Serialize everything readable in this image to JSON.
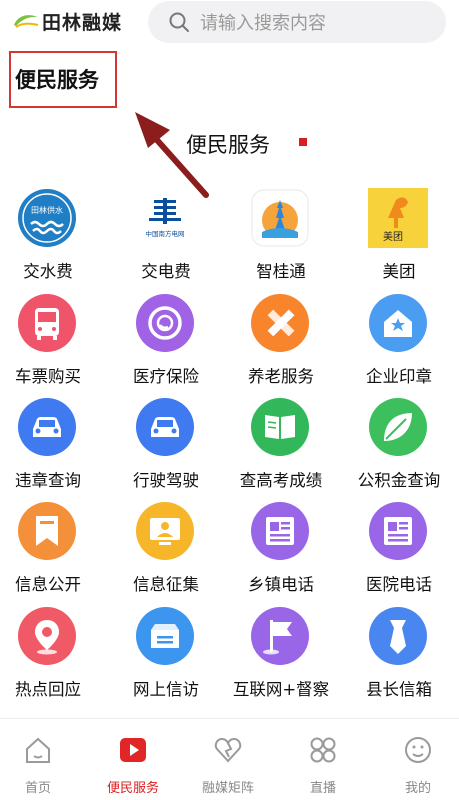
{
  "header": {
    "logo_text": "田林融媒",
    "logo_small": "Tianlin",
    "search_placeholder": "请输入搜索内容"
  },
  "annotation": {
    "label": "便民服务"
  },
  "section": {
    "title": "便民服务"
  },
  "services": [
    {
      "label": "交水费",
      "icon": "water-company-icon",
      "color": "#1f7ec4"
    },
    {
      "label": "交电费",
      "icon": "china-southern-grid-icon",
      "color": "#0a4f9b",
      "caption": "中国南方电网"
    },
    {
      "label": "智桂通",
      "icon": "zhiguitong-icon",
      "color": "#3aa0dd"
    },
    {
      "label": "美团",
      "icon": "meituan-icon",
      "color": "#f7d23b",
      "caption": "美团"
    },
    {
      "label": "车票购买",
      "icon": "bus-icon",
      "color": "#f0546a"
    },
    {
      "label": "医疗保险",
      "icon": "medical-insurance-icon",
      "color": "#a063e6"
    },
    {
      "label": "养老服务",
      "icon": "pencil-ruler-icon",
      "color": "#f8852c"
    },
    {
      "label": "企业印章",
      "icon": "house-badge-icon",
      "color": "#4a9df0"
    },
    {
      "label": "违章查询",
      "icon": "car-icon",
      "color": "#3f7af0"
    },
    {
      "label": "行驶驾驶",
      "icon": "car-icon",
      "color": "#3f7af0"
    },
    {
      "label": "查高考成绩",
      "icon": "book-icon",
      "color": "#32b85a"
    },
    {
      "label": "公积金查询",
      "icon": "leaf-icon",
      "color": "#3cbf5c"
    },
    {
      "label": "信息公开",
      "icon": "bookmark-icon",
      "color": "#f5903a"
    },
    {
      "label": "信息征集",
      "icon": "screen-person-icon",
      "color": "#f7b52a"
    },
    {
      "label": "乡镇电话",
      "icon": "document-icon",
      "color": "#9a66e8"
    },
    {
      "label": "医院电话",
      "icon": "document-icon",
      "color": "#9a66e8"
    },
    {
      "label": "热点回应",
      "icon": "location-pin-icon",
      "color": "#f05a66"
    },
    {
      "label": "网上信访",
      "icon": "mailbox-icon",
      "color": "#3c95ee"
    },
    {
      "label": "互联网+督察",
      "icon": "flag-icon",
      "color": "#9966e8"
    },
    {
      "label": "县长信箱",
      "icon": "tie-icon",
      "color": "#4a86f0"
    }
  ],
  "tabs": [
    {
      "label": "首页",
      "icon": "home-icon",
      "active": false
    },
    {
      "label": "便民服务",
      "icon": "play-icon",
      "active": true
    },
    {
      "label": "融媒矩阵",
      "icon": "heart-icon",
      "active": false
    },
    {
      "label": "直播",
      "icon": "grid-icon",
      "active": false
    },
    {
      "label": "我的",
      "icon": "smile-icon",
      "active": false
    }
  ],
  "colors": {
    "accent": "#d81e1e",
    "annotation": "#d93434",
    "muted": "#888888"
  }
}
